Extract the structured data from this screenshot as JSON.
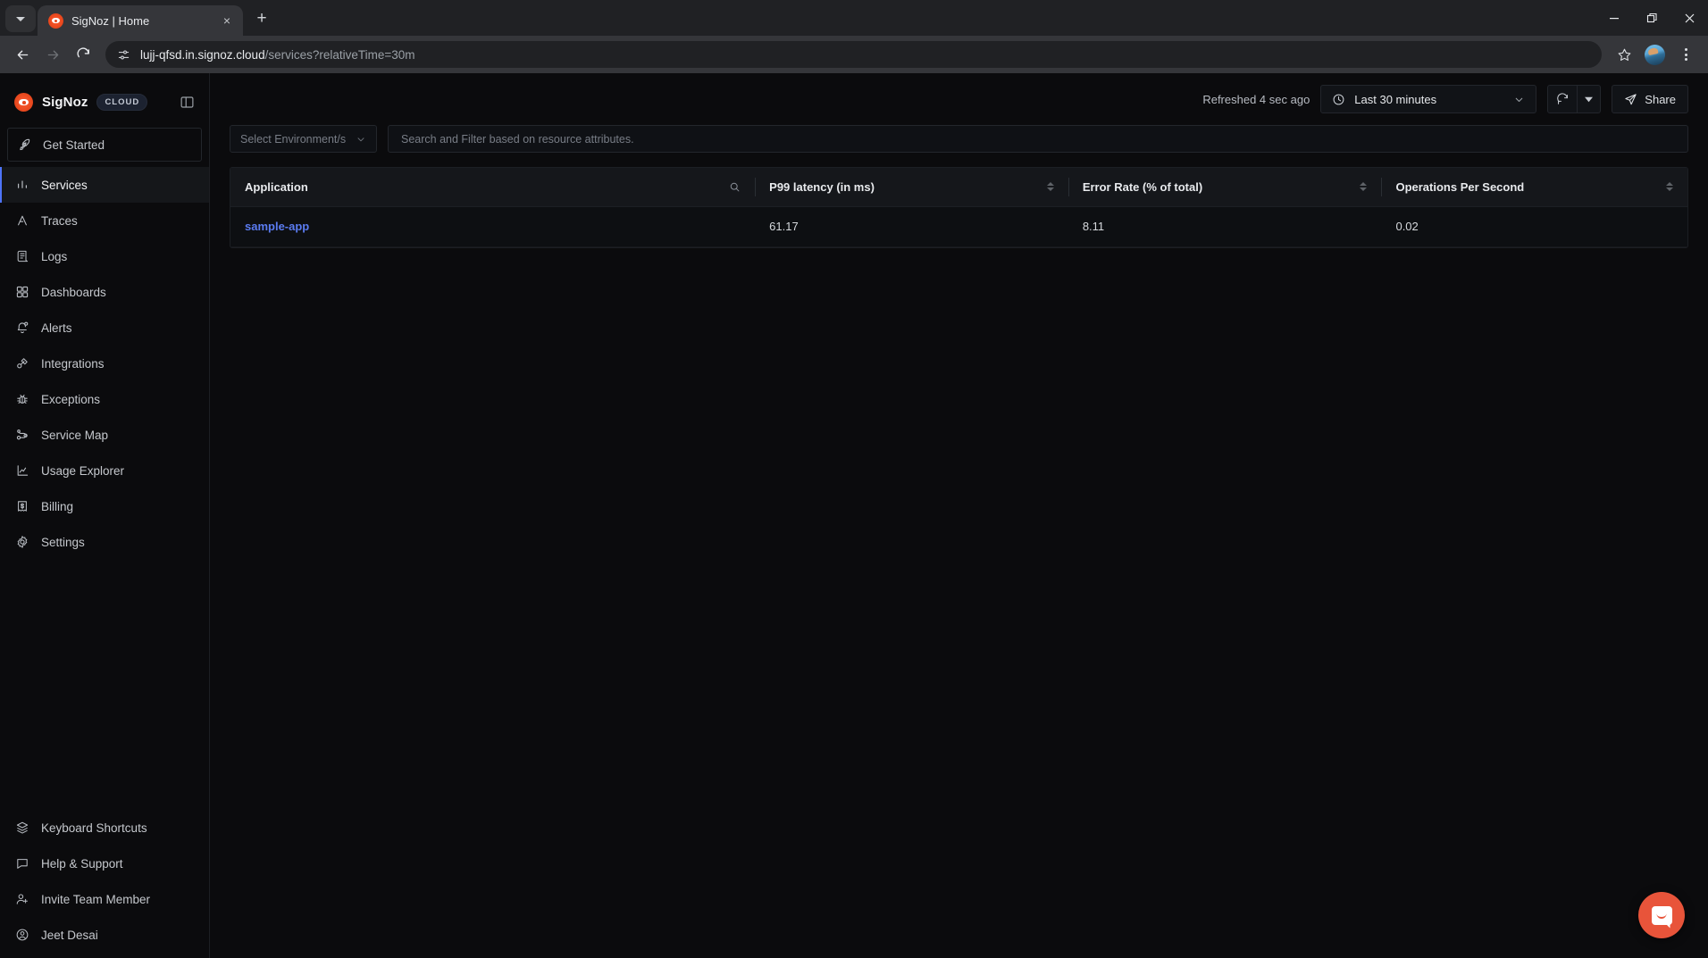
{
  "browser": {
    "tab": {
      "title": "SigNoz | Home",
      "favicon": "signoz-icon",
      "close_label": "×"
    },
    "new_tab_label": "+",
    "tab_list_icon": "chevron-down-icon",
    "window": {
      "minimize": "–",
      "restore": "❐",
      "close": "✕"
    },
    "nav": {
      "back": "←",
      "forward": "→",
      "reload": "⟳"
    },
    "omnibox": {
      "site_info_icon": "page-settings-icon",
      "url_host": "lujj-qfsd.in.signoz.cloud",
      "url_path": "/services?relativeTime=30m"
    },
    "actions": {
      "bookmark": "star-icon",
      "profile": "avatar",
      "menu": "three-dot-menu-icon"
    }
  },
  "sidebar": {
    "brand": {
      "name": "SigNoz",
      "badge": "CLOUD",
      "logo": "signoz-logo-icon"
    },
    "collapse_icon": "panel-collapse-icon",
    "items": [
      {
        "label": "Get Started",
        "icon": "rocket-icon",
        "state": "boxed"
      },
      {
        "label": "Services",
        "icon": "bar-chart-icon",
        "state": "active"
      },
      {
        "label": "Traces",
        "icon": "traces-icon",
        "state": "normal"
      },
      {
        "label": "Logs",
        "icon": "logs-icon",
        "state": "normal"
      },
      {
        "label": "Dashboards",
        "icon": "grid-icon",
        "state": "normal"
      },
      {
        "label": "Alerts",
        "icon": "bell-icon",
        "state": "normal"
      },
      {
        "label": "Integrations",
        "icon": "integrations-icon",
        "state": "normal"
      },
      {
        "label": "Exceptions",
        "icon": "bug-icon",
        "state": "normal"
      },
      {
        "label": "Service Map",
        "icon": "service-map-icon",
        "state": "normal"
      },
      {
        "label": "Usage Explorer",
        "icon": "usage-chart-icon",
        "state": "normal"
      },
      {
        "label": "Billing",
        "icon": "receipt-icon",
        "state": "normal"
      },
      {
        "label": "Settings",
        "icon": "gear-icon",
        "state": "normal"
      }
    ],
    "bottom_items": [
      {
        "label": "Keyboard Shortcuts",
        "icon": "layers-icon"
      },
      {
        "label": "Help & Support",
        "icon": "message-icon"
      },
      {
        "label": "Invite Team Member",
        "icon": "user-plus-icon"
      },
      {
        "label": "Jeet Desai",
        "icon": "user-circle-icon"
      }
    ]
  },
  "topbar": {
    "refreshed_text": "Refreshed 4 sec ago",
    "time_range": "Last 30 minutes",
    "time_icon": "clock-icon",
    "time_chevron": "chevron-down-icon",
    "refresh_icon": "refresh-icon",
    "refresh_dropdown_icon": "caret-down-icon",
    "share_label": "Share",
    "share_icon": "send-icon"
  },
  "filters": {
    "environment_placeholder": "Select Environment/s",
    "environment_chevron": "chevron-down-icon",
    "search_placeholder": "Search and Filter based on resource attributes."
  },
  "table": {
    "columns": [
      {
        "label": "Application",
        "icon": "search-icon",
        "sortable": false
      },
      {
        "label": "P99 latency (in ms)",
        "icon": "sort-icon",
        "sortable": true
      },
      {
        "label": "Error Rate (% of total)",
        "icon": "sort-icon",
        "sortable": true
      },
      {
        "label": "Operations Per Second",
        "icon": "sort-icon",
        "sortable": true
      }
    ],
    "rows": [
      {
        "application": "sample-app",
        "p99_latency": "61.17",
        "error_rate": "8.11",
        "ops_per_second": "0.02"
      }
    ]
  },
  "chat": {
    "icon": "intercom-chat-icon"
  },
  "colors": {
    "accent": "#4e74f8",
    "link": "#5a7bf0",
    "brand": "#e5461c",
    "chat": "#e8543a",
    "bg": "#0b0b0d"
  }
}
